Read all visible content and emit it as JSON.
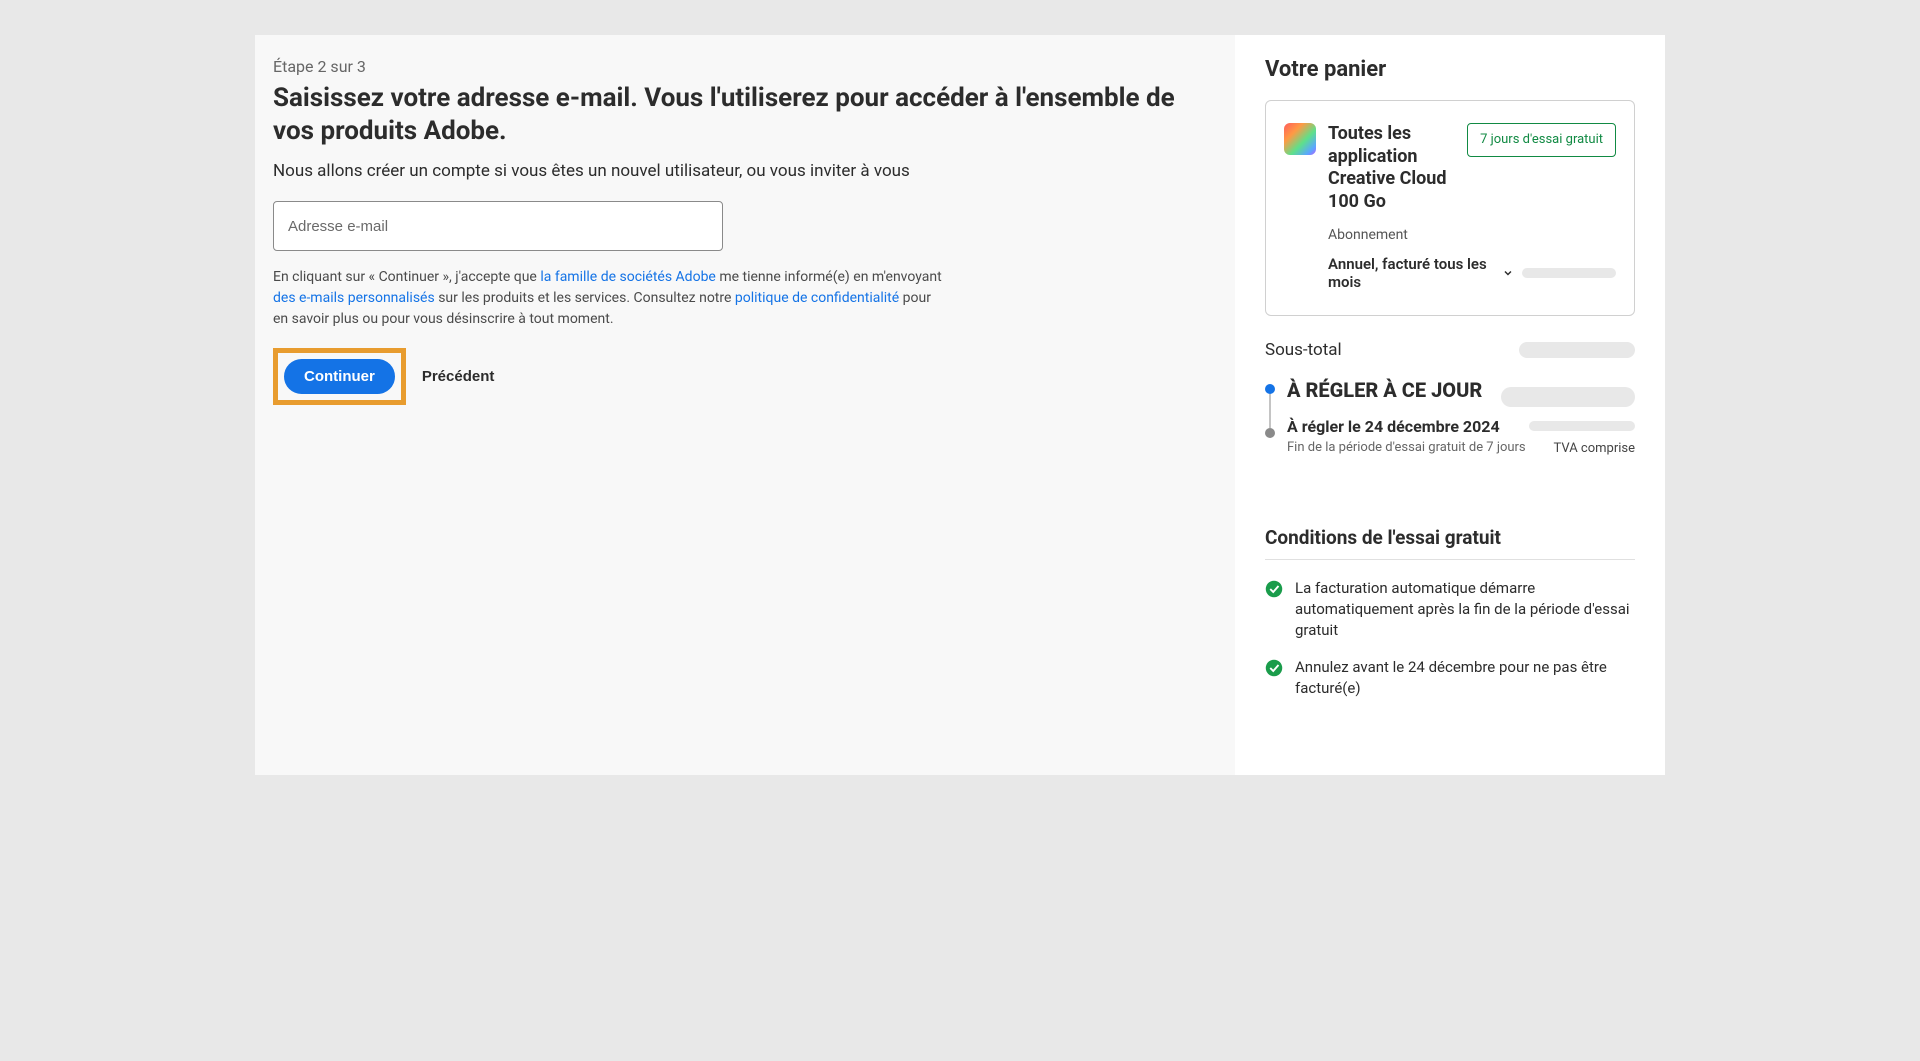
{
  "step": "Étape 2 sur 3",
  "title": "Saisissez votre adresse e-mail. Vous l'utiliserez pour accéder à l'ensemble de vos produits Adobe.",
  "subtitle": "Nous allons créer un compte si vous êtes un nouvel utilisateur, ou vous inviter à vous",
  "email": {
    "placeholder": "Adresse e-mail"
  },
  "legal": {
    "t1": "En cliquant sur « Continuer », j'accepte que ",
    "link1": "la famille de sociétés Adobe",
    "t2": " me tienne informé(e) en m'envoyant ",
    "link2": "des e-mails personnalisés",
    "t3": " sur les produits et les services. Consultez notre ",
    "link3": "politique de confidentialité",
    "t4": " pour en savoir plus ou pour vous désinscrire à tout moment."
  },
  "buttons": {
    "continue": "Continuer",
    "previous": "Précédent"
  },
  "cart": {
    "title": "Votre panier",
    "product": "Toutes les application Creative Cloud 100 Go",
    "trial_badge": "7 jours d'essai gratuit",
    "subscription_label": "Abonnement",
    "subscription_value": "Annuel, facturé tous les mois",
    "subtotal": "Sous-total",
    "due_today": "À RÉGLER À CE JOUR",
    "due_later": "À régler le 24 décembre 2024",
    "due_note": "Fin de la période d'essai gratuit de 7 jours",
    "vat": "TVA comprise"
  },
  "terms": {
    "title": "Conditions de l'essai gratuit",
    "items": [
      "La facturation automatique démarre automatiquement après la fin de la période d'essai gratuit",
      "Annulez avant le 24 décembre pour ne pas être facturé(e)"
    ]
  }
}
